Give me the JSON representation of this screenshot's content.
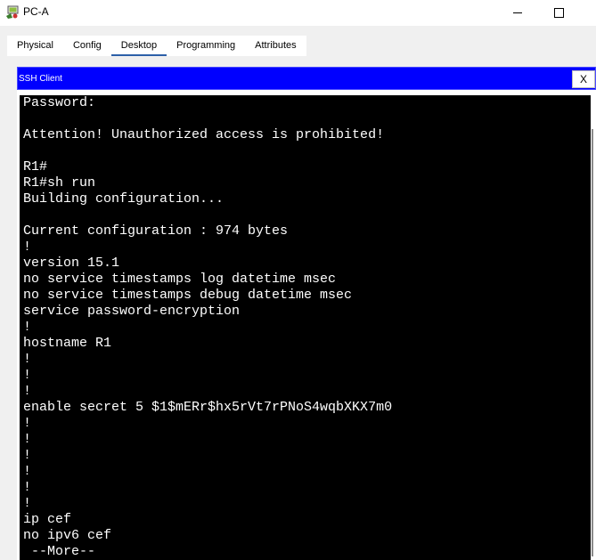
{
  "window": {
    "title": "PC-A",
    "icon": "packet-tracer-pc-icon"
  },
  "tabs": [
    {
      "label": "Physical",
      "active": false
    },
    {
      "label": "Config",
      "active": false
    },
    {
      "label": "Desktop",
      "active": true
    },
    {
      "label": "Programming",
      "active": false
    },
    {
      "label": "Attributes",
      "active": false
    }
  ],
  "ssh": {
    "title": "SSH Client",
    "close_label": "X"
  },
  "terminal": {
    "lines": [
      "Password:",
      "",
      "Attention! Unauthorized access is prohibited!",
      "",
      "R1#",
      "R1#sh run",
      "Building configuration...",
      "",
      "Current configuration : 974 bytes",
      "!",
      "version 15.1",
      "no service timestamps log datetime msec",
      "no service timestamps debug datetime msec",
      "service password-encryption",
      "!",
      "hostname R1",
      "!",
      "!",
      "!",
      "enable secret 5 $1$mERr$hx5rVt7rPNoS4wqbXKX7m0",
      "!",
      "!",
      "!",
      "!",
      "!",
      "!",
      "ip cef",
      "no ipv6 cef",
      " --More--"
    ]
  },
  "colors": {
    "ssh_header": "#0000ff",
    "terminal_bg": "#000000",
    "terminal_fg": "#ffffff",
    "tab_active_underline": "#2c5fa8"
  }
}
